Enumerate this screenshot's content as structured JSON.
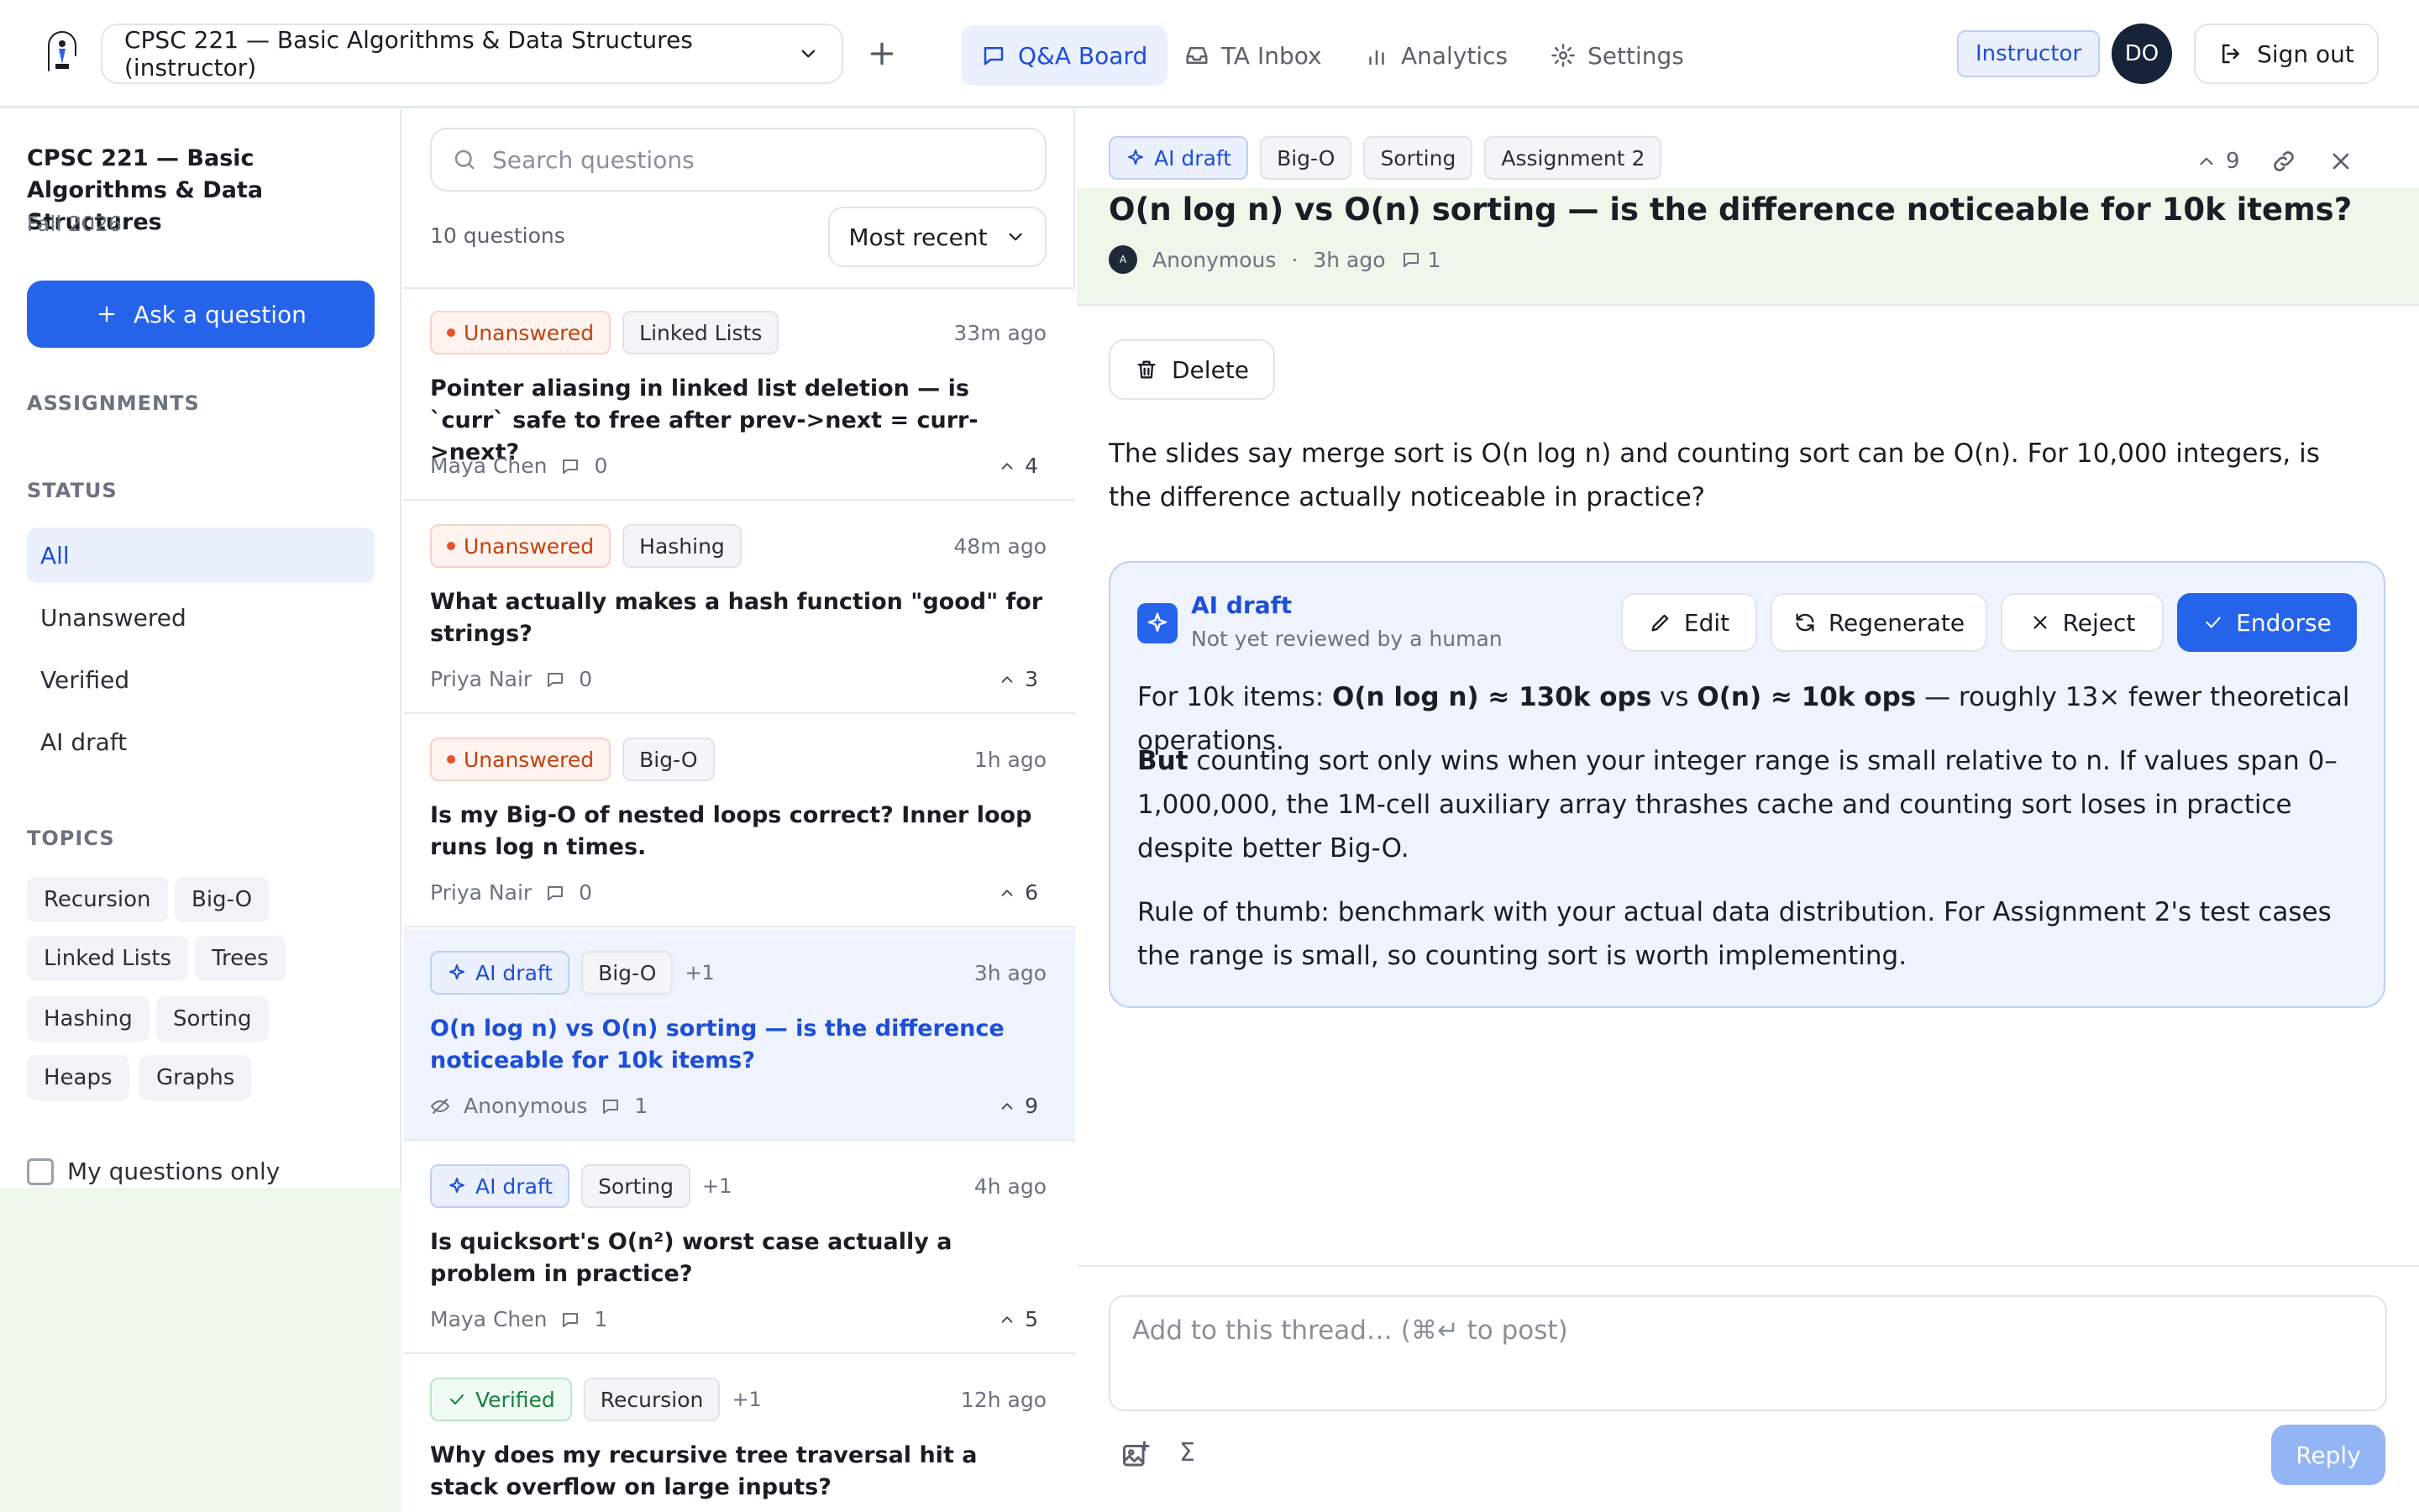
{
  "header": {
    "course": "CPSC 221 — Basic Algorithms & Data Structures (instructor)",
    "tabs": [
      {
        "label": "Q&A Board",
        "icon": "chat-icon",
        "active": true
      },
      {
        "label": "TA Inbox",
        "icon": "inbox-icon",
        "active": false
      },
      {
        "label": "Analytics",
        "icon": "bar-chart-icon",
        "active": false
      },
      {
        "label": "Settings",
        "icon": "gear-icon",
        "active": false
      }
    ],
    "role_badge": "Instructor",
    "avatar_initials": "DO",
    "sign_out": "Sign out"
  },
  "sidebar": {
    "course_title": "CPSC 221 — Basic Algorithms & Data Structures",
    "term": "Fall 2026",
    "ask_button": "Ask a question",
    "assignments_heading": "ASSIGNMENTS",
    "status_heading": "STATUS",
    "status_items": [
      "All",
      "Unanswered",
      "Verified",
      "AI draft"
    ],
    "topics_heading": "TOPICS",
    "topics": [
      "Recursion",
      "Big-O",
      "Linked Lists",
      "Trees",
      "Hashing",
      "Sorting",
      "Heaps",
      "Graphs"
    ],
    "my_questions_only": "My questions only"
  },
  "list": {
    "search_placeholder": "Search questions",
    "count": "10 questions",
    "sort": "Most recent",
    "items": [
      {
        "status": "Unanswered",
        "tag": "Linked Lists",
        "more": "",
        "time": "33m ago",
        "title": "Pointer aliasing in linked list deletion — is `curr` safe to free after prev->next = curr->next?",
        "author": "Maya Chen",
        "replies": "0",
        "votes": "4"
      },
      {
        "status": "Unanswered",
        "tag": "Hashing",
        "more": "",
        "time": "48m ago",
        "title": "What actually makes a hash function \"good\" for strings?",
        "author": "Priya Nair",
        "replies": "0",
        "votes": "3"
      },
      {
        "status": "Unanswered",
        "tag": "Big-O",
        "more": "",
        "time": "1h ago",
        "title": "Is my Big-O of nested loops correct? Inner loop runs log n times.",
        "author": "Priya Nair",
        "replies": "0",
        "votes": "6"
      },
      {
        "status": "AI draft",
        "tag": "Big-O",
        "more": "+1",
        "time": "3h ago",
        "title": "O(n log n) vs O(n) sorting — is the difference noticeable for 10k items?",
        "author": "Anonymous",
        "replies": "1",
        "votes": "9"
      },
      {
        "status": "AI draft",
        "tag": "Sorting",
        "more": "+1",
        "time": "4h ago",
        "title": "Is quicksort's O(n²) worst case actually a problem in practice?",
        "author": "Maya Chen",
        "replies": "1",
        "votes": "5"
      },
      {
        "status": "Verified",
        "tag": "Recursion",
        "more": "+1",
        "time": "12h ago",
        "title": "Why does my recursive tree traversal hit a stack overflow on large inputs?",
        "author": "",
        "replies": "",
        "votes": ""
      }
    ]
  },
  "detail": {
    "tags": [
      "AI draft",
      "Big-O",
      "Sorting",
      "Assignment 2"
    ],
    "votes": "9",
    "title": "O(n log n) vs O(n) sorting — is the difference noticeable for 10k items?",
    "author": "Anonymous",
    "avatar_letter": "A",
    "time": "3h ago",
    "replies": "1",
    "delete_label": "Delete",
    "body": "The slides say merge sort is O(n log n) and counting sort can be O(n). For 10,000 integers, is the difference actually noticeable in practice?",
    "ai": {
      "label": "AI draft",
      "sub": "Not yet reviewed by a human",
      "edit": "Edit",
      "regenerate": "Regenerate",
      "reject": "Reject",
      "endorse": "Endorse",
      "p1_a": "For 10k items: ",
      "p1_b": "O(n log n) ≈ 130k ops",
      "p1_c": " vs ",
      "p1_d": "O(n) ≈ 10k ops",
      "p1_e": " — roughly 13× fewer theoretical operations.",
      "p2_a": "But",
      "p2_b": " counting sort only wins when your integer range is small relative to n. If values span 0–1,000,000, the 1M-cell auxiliary array thrashes cache and counting sort loses in practice despite better Big-O.",
      "p3": "Rule of thumb: benchmark with your actual data distribution. For Assignment 2's test cases the range is small, so counting sort is worth implementing."
    },
    "composer_placeholder": "Add to this thread… (⌘↵ to post)",
    "reply": "Reply"
  },
  "colors": {
    "accent": "#2563eb",
    "unanswered": "#c2410c",
    "verified": "#15803d"
  }
}
